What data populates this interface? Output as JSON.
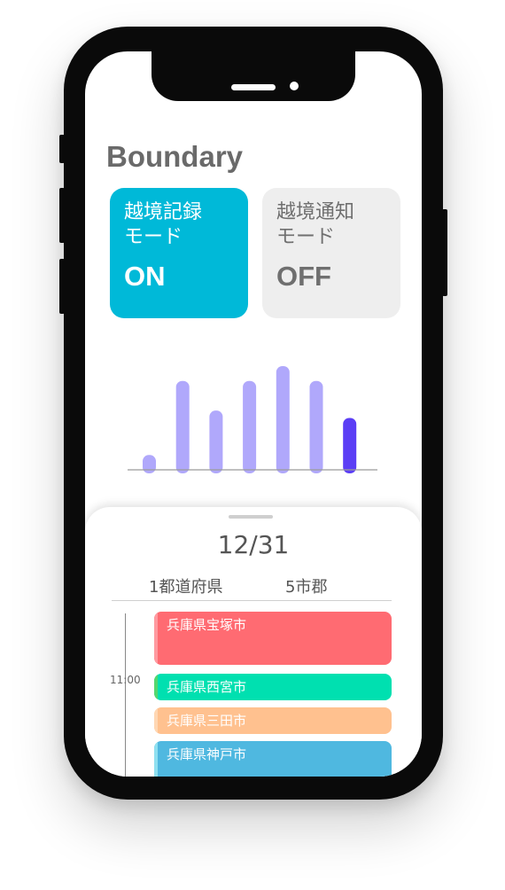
{
  "app": {
    "title": "Boundary"
  },
  "modes": [
    {
      "label": "越境記録\nモード",
      "state": "ON",
      "active": true,
      "color": "#00b9d8"
    },
    {
      "label": "越境通知\nモード",
      "state": "OFF",
      "active": false,
      "color": "#eeeeee"
    }
  ],
  "chart_data": {
    "type": "bar",
    "series": [
      {
        "values": [
          2,
          12,
          8,
          12,
          14,
          12,
          7
        ]
      }
    ],
    "highlight_index": 6,
    "colors": {
      "default": "#b0a8fb",
      "highlight": "#5b3ef5"
    }
  },
  "sheet": {
    "date": "12/31",
    "prefecture_count": "1都道府県",
    "city_count": "5市郡",
    "time_label": "11:00",
    "events": [
      {
        "name": "兵庫県宝塚市",
        "color": "#ff6b72",
        "stripe": "#ff9aa0"
      },
      {
        "name": "兵庫県西宮市",
        "color": "#00e0b0",
        "stripe": "#55d66e"
      },
      {
        "name": "兵庫県三田市",
        "color": "#ffc18f",
        "stripe": "#ffd7b3"
      },
      {
        "name": "兵庫県神戸市",
        "color": "#4fb8e0",
        "stripe": "#8fe0f0"
      }
    ]
  }
}
